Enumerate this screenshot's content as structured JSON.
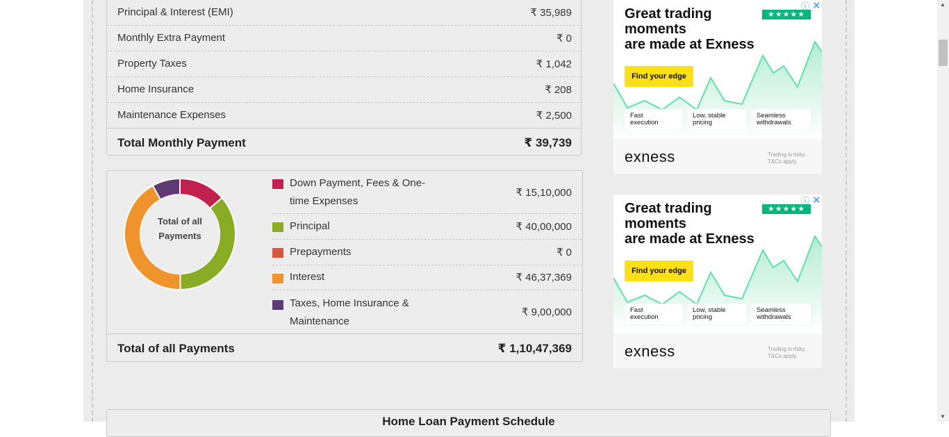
{
  "monthly": {
    "rows": [
      {
        "label": "Principal & Interest (EMI)",
        "value": "₹ 35,989"
      },
      {
        "label": "Monthly Extra Payment",
        "value": "₹ 0"
      },
      {
        "label": "Property Taxes",
        "value": "₹ 1,042"
      },
      {
        "label": "Home Insurance",
        "value": "₹ 208"
      },
      {
        "label": "Maintenance Expenses",
        "value": "₹ 2,500"
      }
    ],
    "total_label": "Total Monthly Payment",
    "total_value": "₹ 39,739"
  },
  "payments": {
    "donut_label": "Total of all Payments",
    "legend": [
      {
        "label": "Down Payment, Fees & One-time Expenses",
        "value": "₹ 15,10,000",
        "color": "#c0214f"
      },
      {
        "label": "Principal",
        "value": "₹ 40,00,000",
        "color": "#8aab24"
      },
      {
        "label": "Prepayments",
        "value": "₹ 0",
        "color": "#d85540"
      },
      {
        "label": "Interest",
        "value": "₹ 46,37,369",
        "color": "#ef942d"
      },
      {
        "label": "Taxes, Home Insurance & Maintenance",
        "value": "₹ 9,00,000",
        "color": "#5f3a72"
      }
    ],
    "total_label": "Total of all Payments",
    "total_value": "₹ 1,10,47,369"
  },
  "ads": [
    {
      "headline": [
        "Great trading",
        "moments",
        "are made at Exness"
      ],
      "button": "Find your edge",
      "features": [
        [
          "Fast",
          "execution"
        ],
        [
          "Low, stable",
          "pricing"
        ],
        [
          "Seamless",
          "withdrawals"
        ]
      ],
      "brand": "exness",
      "disclaimer": [
        "Trading is risky.",
        "T&Cs apply."
      ]
    },
    {
      "headline": [
        "Great trading",
        "moments",
        "are made at Exness"
      ],
      "button": "Find your edge",
      "features": [
        [
          "Fast",
          "execution"
        ],
        [
          "Low, stable",
          "pricing"
        ],
        [
          "Seamless",
          "withdrawals"
        ]
      ],
      "brand": "exness",
      "disclaimer": [
        "Trading is risky.",
        "T&Cs apply."
      ]
    }
  ],
  "schedule": {
    "title": "Home Loan Payment Schedule"
  }
}
